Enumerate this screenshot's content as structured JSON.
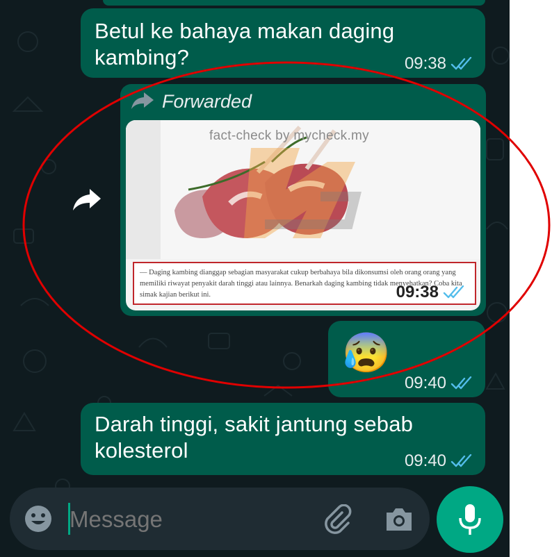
{
  "chat": {
    "messages": [
      {
        "text": "Betul ke bahaya makan daging kambing?",
        "time": "09:38"
      },
      {
        "forwarded_label": "Forwarded",
        "time": "09:38",
        "image": {
          "watermark": "fact-check by mycheck.my",
          "caption": "— Daging kambing dianggap sebagian masyarakat cukup berbahaya bila dikonsumsi oleh orang orang yang memiliki riwayat penyakit darah tinggi atau lainnya. Benarkah daging kambing tidak menyehatkan? Coba kita simak kajian berikut ini."
        }
      },
      {
        "emoji": "😰",
        "time": "09:40"
      },
      {
        "text": "Darah tinggi, sakit jantung sebab kolesterol",
        "time": "09:40"
      }
    ]
  },
  "input": {
    "placeholder": "Message"
  },
  "icons": {
    "emoji": "emoji-icon",
    "attach": "paperclip-icon",
    "camera": "camera-icon",
    "mic": "mic-icon",
    "forward": "forward-icon",
    "read_receipt": "double-check-icon"
  },
  "colors": {
    "bubble": "#005c4b",
    "accent": "#00a884",
    "read_tick": "#53bdeb",
    "annotation": "#e00000"
  }
}
